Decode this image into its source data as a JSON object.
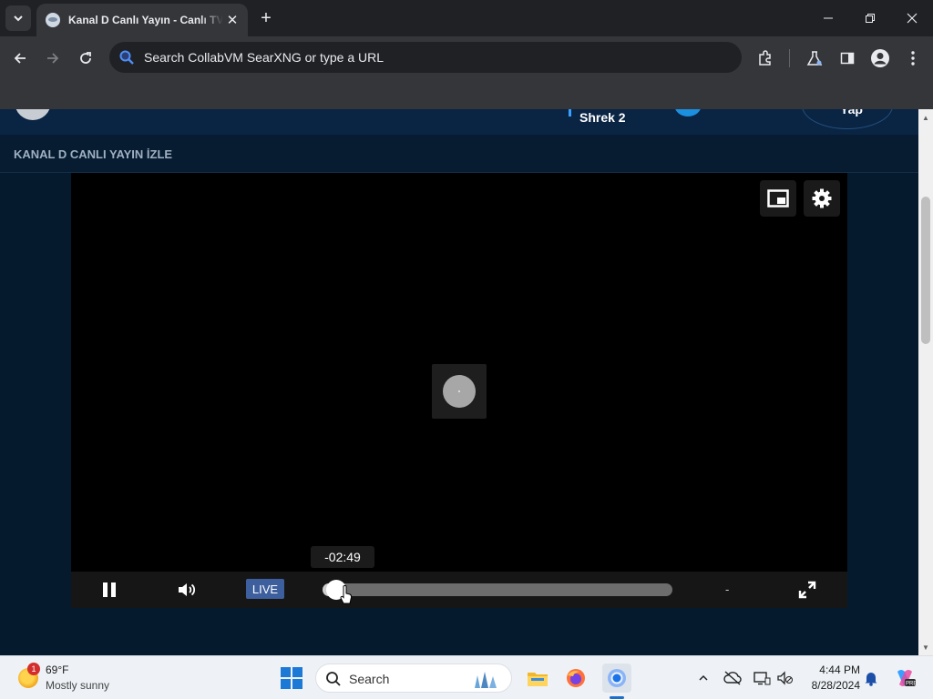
{
  "browser": {
    "tab_title": "Kanal D Canlı Yayın - Canlı TV İzle",
    "omnibox_placeholder": "Search CollabVM SearXNG or type a URL",
    "accent": "#35363a"
  },
  "page": {
    "show_title": "Shrek 2",
    "menu_text": "Yap",
    "section_title": "KANAL D CANLI YAYIN İZLE",
    "background": "#061a2e"
  },
  "player": {
    "time_tooltip": "-02:49",
    "live_label": "LIVE",
    "duration": "-",
    "progress": 0.04,
    "live_color": "#3d5f9e"
  },
  "taskbar": {
    "weather_badge": "1",
    "temperature": "69°F",
    "weather_desc": "Mostly sunny",
    "search_label": "Search",
    "time": "4:44 PM",
    "date": "8/28/2024"
  },
  "icons": {
    "tab_list": "chevron-down-icon",
    "favicon": "kanal-d-favicon",
    "close": "close-icon",
    "new_tab": "plus-icon",
    "minimize": "minimize-icon",
    "restore": "restore-icon",
    "window_close": "close-icon",
    "back": "back-arrow-icon",
    "forward": "forward-arrow-icon",
    "reload": "reload-icon",
    "search": "search-icon",
    "extensions": "puzzle-icon",
    "labs": "flask-icon",
    "side_panel": "side-panel-icon",
    "profile": "profile-icon",
    "menu": "kebab-menu-icon",
    "pip": "picture-in-picture-icon",
    "settings": "gear-icon",
    "pause": "pause-icon",
    "volume": "volume-icon",
    "fullscreen": "fullscreen-icon"
  }
}
